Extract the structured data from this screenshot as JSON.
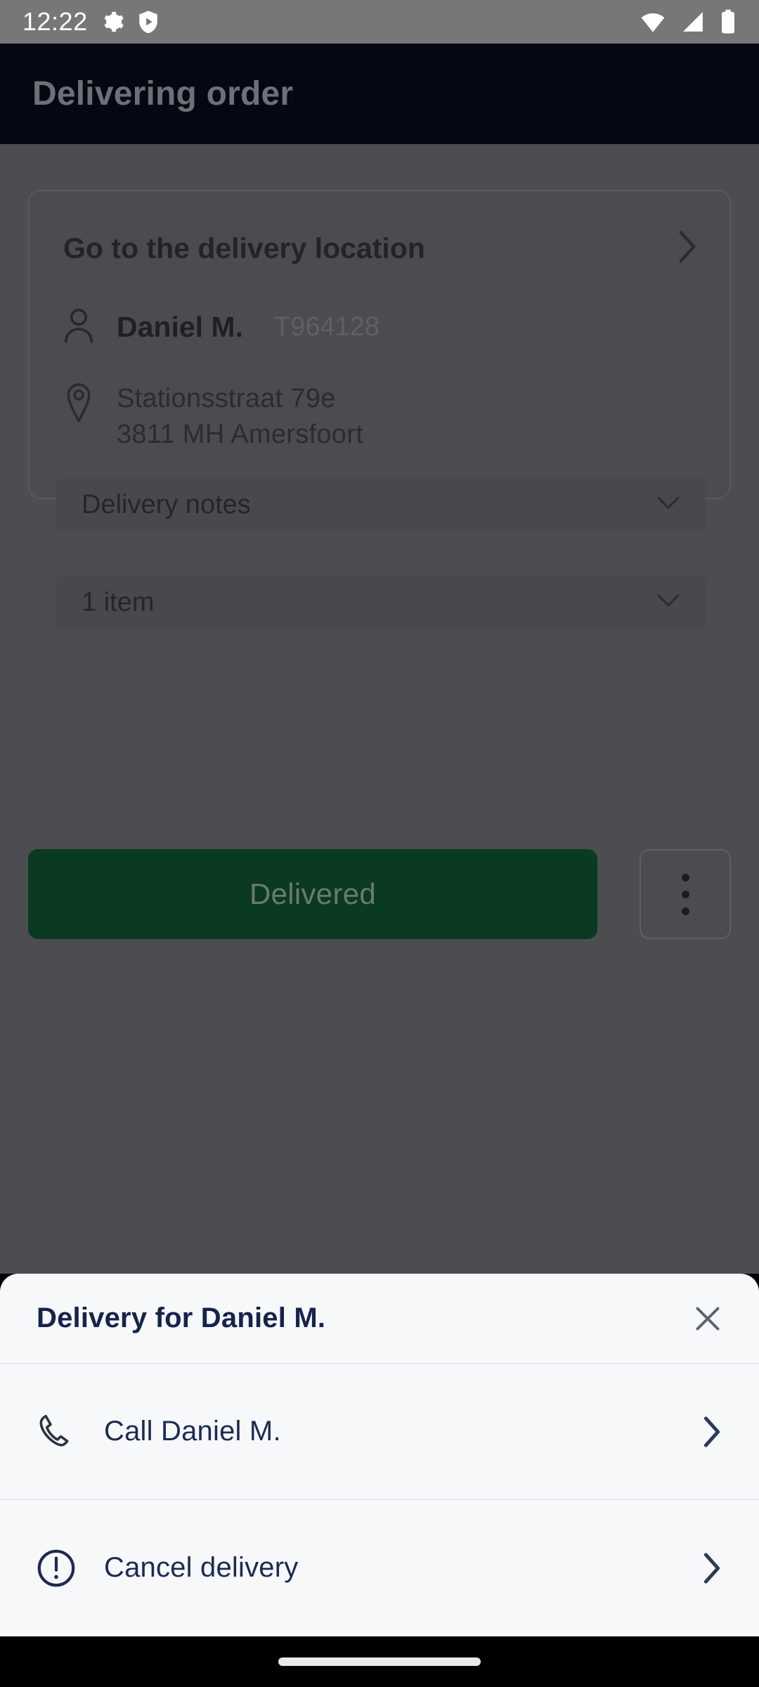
{
  "status_bar": {
    "time": "12:22",
    "left_icons": [
      "gear-icon",
      "shield-play-icon"
    ],
    "right_icons": [
      "wifi-icon",
      "cellular-signal-icon",
      "battery-icon"
    ],
    "background_color": "#77777a"
  },
  "app_bar": {
    "title": "Delivering order",
    "background_color": "#050813",
    "title_color": "#6e7078"
  },
  "order_card": {
    "goto": {
      "label": "Go to the delivery location",
      "chevron": "chevron-right-icon"
    },
    "customer": {
      "icon": "person-icon",
      "name": "Daniel M.",
      "reference": "T964128"
    },
    "address": {
      "icon": "location-pin-icon",
      "line1": "Stationsstraat 79e",
      "line2": "3811 MH  Amersfoort"
    },
    "collapsibles": [
      {
        "label": "Delivery notes",
        "chevron": "chevron-down-icon"
      },
      {
        "label": "1 item",
        "chevron": "chevron-down-icon"
      }
    ]
  },
  "actions": {
    "primary_label": "Delivered",
    "primary_color": "#0a3a21",
    "overflow_icon": "kebab-menu-icon"
  },
  "bottom_sheet": {
    "title": "Delivery for Daniel M.",
    "close_icon": "close-icon",
    "title_color": "#15244a",
    "background_color": "#f7f8fa",
    "options": [
      {
        "icon": "phone-icon",
        "label": "Call Daniel M.",
        "chevron": "chevron-right-icon"
      },
      {
        "icon": "exclamation-circle-icon",
        "label": "Cancel delivery",
        "chevron": "chevron-right-icon"
      }
    ]
  },
  "nav_bar": {
    "home_indicator": "home-indicator"
  }
}
